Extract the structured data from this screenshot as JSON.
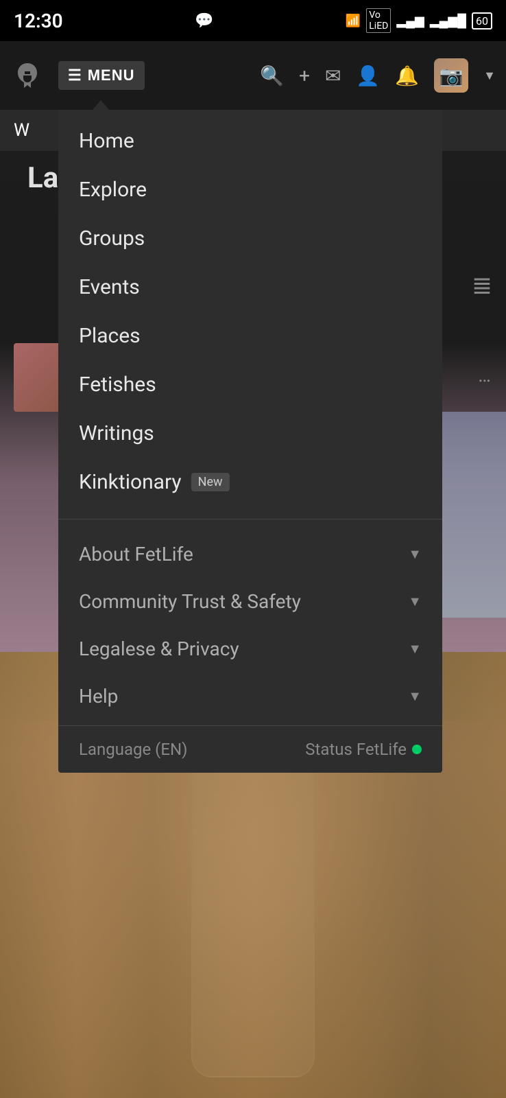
{
  "statusBar": {
    "time": "12:30",
    "batteryLevel": "60"
  },
  "navBar": {
    "menuLabel": "MENU",
    "logoAlt": "FetLife logo"
  },
  "menu": {
    "mainItems": [
      {
        "id": "home",
        "label": "Home",
        "badge": null
      },
      {
        "id": "explore",
        "label": "Explore",
        "badge": null
      },
      {
        "id": "groups",
        "label": "Groups",
        "badge": null
      },
      {
        "id": "events",
        "label": "Events",
        "badge": null
      },
      {
        "id": "places",
        "label": "Places",
        "badge": null
      },
      {
        "id": "fetishes",
        "label": "Fetishes",
        "badge": null
      },
      {
        "id": "writings",
        "label": "Writings",
        "badge": null
      },
      {
        "id": "kinktionary",
        "label": "Kinktionary",
        "badge": "New"
      }
    ],
    "expandableItems": [
      {
        "id": "about-fetlife",
        "label": "About FetLife"
      },
      {
        "id": "community-trust-safety",
        "label": "Community Trust & Safety"
      },
      {
        "id": "legalese-privacy",
        "label": "Legalese & Privacy"
      },
      {
        "id": "help",
        "label": "Help"
      }
    ],
    "footer": {
      "language": "Language (EN)",
      "statusLabel": "Status FetLife",
      "statusColor": "#00cc66"
    }
  },
  "background": {
    "contentHeaderText": "W",
    "sectionTitle": "Lat"
  }
}
